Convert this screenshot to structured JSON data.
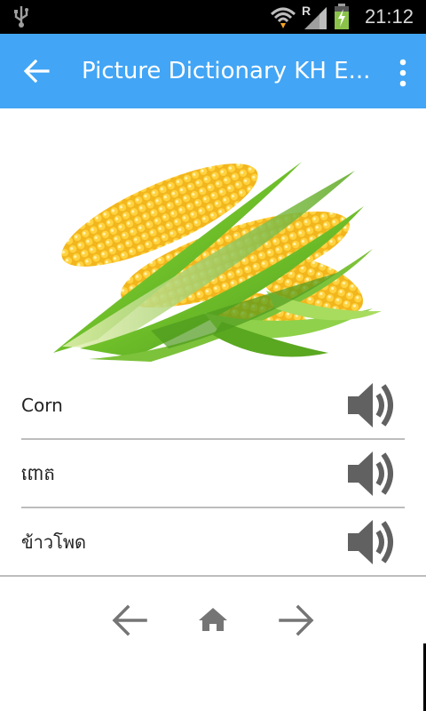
{
  "status_bar": {
    "time": "21:12",
    "roaming_indicator": "R",
    "icons": [
      "usb-icon",
      "wifi-icon",
      "signal-icon",
      "battery-charging-icon"
    ]
  },
  "app_bar": {
    "title": "Picture Dictionary KH E...",
    "back_icon": "arrow-back-icon",
    "menu_icon": "more-vert-icon",
    "color": "#42a5f5"
  },
  "main": {
    "image_subject": "corn",
    "entries": [
      {
        "word": "Corn",
        "audio_icon": "speaker-icon"
      },
      {
        "word": "ពោត",
        "audio_icon": "speaker-icon"
      },
      {
        "word": "ข้าวโพด",
        "audio_icon": "speaker-icon"
      }
    ]
  },
  "bottom_nav": {
    "items": [
      "arrow-left-icon",
      "home-icon",
      "arrow-right-icon"
    ]
  }
}
